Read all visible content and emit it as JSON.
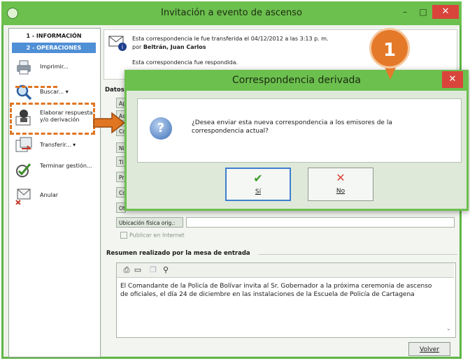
{
  "window": {
    "title": "Invitación a evento de ascenso",
    "minimize": "–",
    "maximize": "□",
    "close": "✕"
  },
  "sidebar": {
    "tab_info": "1 - INFORMACIÓN",
    "tab_ops": "2 - OPERACIONES",
    "items": [
      {
        "label": "Imprimir...",
        "icon": "printer-icon"
      },
      {
        "label": "Buscar...",
        "icon": "search-icon",
        "arrow": "▾"
      },
      {
        "label": "Elaborar respuesta y/o derivación",
        "icon": "reply-icon"
      },
      {
        "label": "Transferir...",
        "icon": "transfer-icon",
        "arrow": "▾"
      },
      {
        "label": "Terminar gestión...",
        "icon": "finish-icon"
      },
      {
        "label": "Anular",
        "icon": "cancel-mail-icon"
      }
    ]
  },
  "notice": {
    "line1": "Esta correspondencia le fue transferida el 04/12/2012 a las 3:13 p. m.",
    "line2_prefix": "por",
    "line2_name": "Beltrán, Juan Carlos",
    "line3": "Esta correspondencia fue respondida."
  },
  "datos": {
    "section_label": "Datos",
    "field_stubs": [
      "Ap",
      "As",
      "Co",
      "Ni",
      "Ti",
      "Pr",
      "Co",
      "Ot"
    ],
    "ubicacion_label": "Ubicación física orig.:",
    "publicar_label": "Publicar en Internet"
  },
  "resumen": {
    "section_label": "Resumen realizado por la mesa de entrada",
    "text": "El Comandante de la Policía de Bolívar invita al Sr. Gobernador a la próxima ceremonia de ascenso de oficiales, el día 24 de diciembre en las instalaciones de la Escuela de Policía de Cartagena"
  },
  "volver_label": "Volver",
  "dialog": {
    "title": "Correspondencia derivada",
    "close": "✕",
    "message": "¿Desea enviar esta nueva correspondencia a los emisores de la correspondencia actual?",
    "yes_label": "Sí",
    "no_label": "No",
    "yes_icon": "check-icon",
    "no_icon": "x-icon"
  },
  "callout_badge": "1",
  "colors": {
    "accent_green": "#6cc04e",
    "close_red": "#d9453b",
    "callout_orange": "#e5792a"
  }
}
